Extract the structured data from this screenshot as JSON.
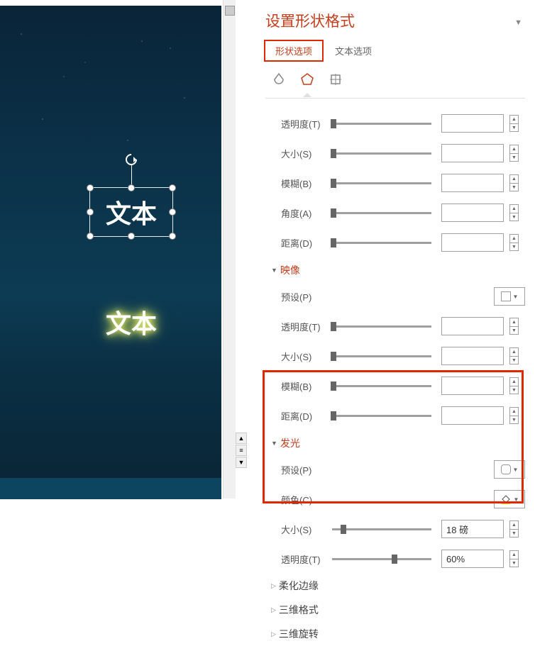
{
  "slide": {
    "text_selected": "文本",
    "text_glow": "文本"
  },
  "pane": {
    "title": "设置形状格式",
    "tabs": {
      "shape": "形状选项",
      "text": "文本选项"
    }
  },
  "shadow": {
    "transparency_label": "透明度(T)",
    "size_label": "大小(S)",
    "blur_label": "模糊(B)",
    "angle_label": "角度(A)",
    "distance_label": "距离(D)"
  },
  "reflection": {
    "header": "映像",
    "preset_label": "预设(P)",
    "transparency_label": "透明度(T)",
    "size_label": "大小(S)",
    "blur_label": "模糊(B)",
    "distance_label": "距离(D)"
  },
  "glow": {
    "header": "发光",
    "preset_label": "预设(P)",
    "color_label": "颜色(C)",
    "size_label": "大小(S)",
    "size_value": "18 磅",
    "transparency_label": "透明度(T)",
    "transparency_value": "60%"
  },
  "collapsed": {
    "softedge": "柔化边缘",
    "format3d": "三维格式",
    "rotate3d": "三维旋转"
  }
}
